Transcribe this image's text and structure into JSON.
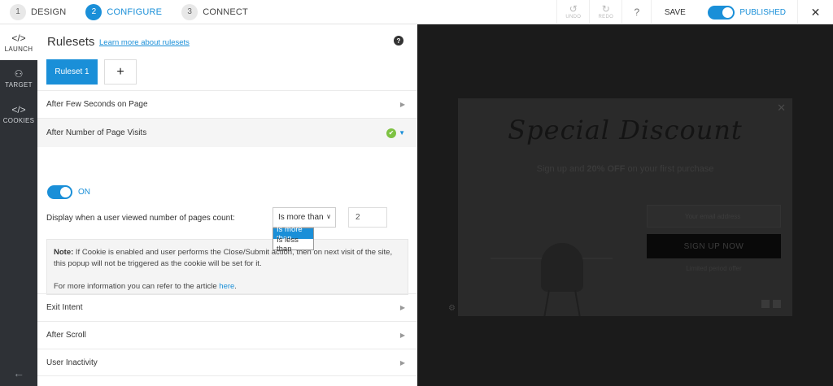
{
  "topbar": {
    "steps": [
      {
        "num": "1",
        "label": "DESIGN"
      },
      {
        "num": "2",
        "label": "CONFIGURE"
      },
      {
        "num": "3",
        "label": "CONNECT"
      }
    ],
    "undo_icon": "↺",
    "undo_label": "UNDO",
    "redo_icon": "↻",
    "redo_label": "REDO",
    "help_label": "?",
    "save_label": "SAVE",
    "published_label": "PUBLISHED",
    "close_label": "✕"
  },
  "leftnav": {
    "items": [
      {
        "icon": "</>",
        "label": "LAUNCH"
      },
      {
        "icon": "⚇",
        "label": "TARGET"
      },
      {
        "icon": "</>",
        "label": "COOKIES"
      }
    ],
    "back_icon": "←"
  },
  "panel": {
    "title": "Rulesets",
    "learn_link": "Learn more about rulesets",
    "help": "?",
    "ruleset_tab": "Ruleset 1",
    "add_label": "+",
    "rules": [
      {
        "label": "After Few Seconds on Page",
        "arrow": "▶"
      },
      {
        "label": "After Number of Page Visits",
        "arrow": "▼",
        "check": "✔"
      },
      {
        "label": "Exit Intent",
        "arrow": "▶"
      },
      {
        "label": "After Scroll",
        "arrow": "▶"
      },
      {
        "label": "User Inactivity",
        "arrow": "▶"
      }
    ],
    "toggle_label": "ON",
    "display_label": "Display when a user viewed number of pages count:",
    "select_value": "Is more than",
    "select_chev": "∨",
    "dropdown_options": [
      "Is more than",
      "Is less than"
    ],
    "count_value": "2",
    "note_bold": "Note:",
    "note_text": " If Cookie is enabled and user performs the Close/Submit action, then on next visit of the site, this popup will not be triggered as the cookie will be set for it.",
    "note_more": "For more information you can refer to the article ",
    "note_link": "here",
    "note_end": "."
  },
  "preview": {
    "close": "✕",
    "title": "Special Discount",
    "sub_pre": "Sign up and ",
    "sub_bold": "20% OFF",
    "sub_post": " on your first purchase",
    "email_placeholder": "Your email address",
    "button": "SIGN UP NOW",
    "limited": "Limited period offer",
    "gear": "⚙"
  }
}
